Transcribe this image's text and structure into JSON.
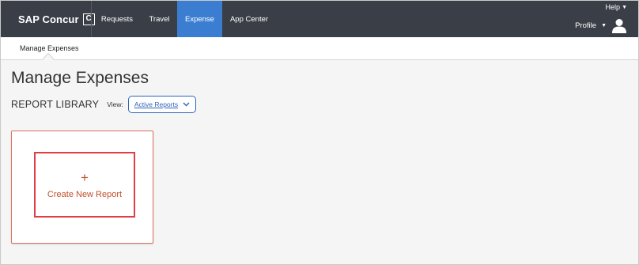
{
  "brand": {
    "name": "SAP Concur",
    "logo_glyph": "C"
  },
  "topnav": {
    "items": [
      {
        "label": "Requests"
      },
      {
        "label": "Travel"
      },
      {
        "label": "Expense",
        "active": true
      },
      {
        "label": "App Center"
      }
    ],
    "help_label": "Help",
    "profile_label": "Profile"
  },
  "subnav": {
    "items": [
      {
        "label": "Manage Expenses"
      }
    ]
  },
  "main": {
    "title": "Manage Expenses",
    "section_title": "REPORT LIBRARY",
    "view_label": "View:",
    "view_value": "Active Reports",
    "create_plus": "+",
    "create_label": "Create New Report"
  },
  "colors": {
    "nav_bg": "#3a3f47",
    "nav_active": "#3b7ed1",
    "link_blue": "#2f64b9",
    "create_text": "#c24e2b",
    "highlight_border": "#e03d44"
  },
  "icons": [
    "concur-logo-icon",
    "caret-down-icon",
    "user-avatar-icon",
    "chevron-down-icon",
    "plus-icon"
  ]
}
